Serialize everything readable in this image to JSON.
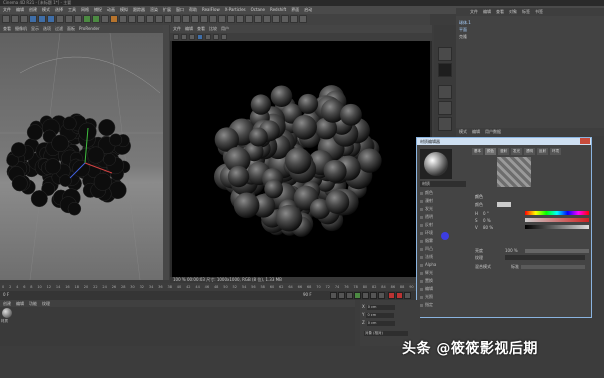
{
  "window": {
    "title": "Cinema 4D R21 - [未标题 1*] - 主要"
  },
  "menubar": [
    "文件",
    "编辑",
    "创建",
    "模式",
    "选择",
    "工具",
    "网格",
    "捕捉",
    "动画",
    "模拟",
    "跟踪器",
    "渲染",
    "扩展",
    "窗口",
    "帮助",
    "RealFlow",
    "X-Particles",
    "Octane",
    "Redshift",
    "界面",
    "启动"
  ],
  "left_viewport": {
    "menu": [
      "查看",
      "摄像机",
      "显示",
      "选项",
      "过滤",
      "面板",
      "ProRender"
    ]
  },
  "render_window": {
    "menu": [
      "文件",
      "编辑",
      "查看",
      "比较",
      "用户"
    ],
    "status": "100 %      00:00:03    尺寸: 1000x1000, RGB (8 位), 1.33 MB"
  },
  "object_manager": {
    "menu": [
      "文件",
      "编辑",
      "查看",
      "对象",
      "标签",
      "书签"
    ],
    "rows": [
      "球体.1",
      "平面",
      "克隆"
    ]
  },
  "attribute_manager": {
    "menu": [
      "模式",
      "编辑",
      "用户数据"
    ]
  },
  "material_editor": {
    "title": "材质编辑器",
    "material_name": "材质",
    "tabs": [
      "基本",
      "颜色",
      "漫射",
      "发光",
      "透明",
      "反射",
      "环境",
      "烟雾"
    ],
    "active_tab": "颜色",
    "channels": [
      "颜色",
      "漫射",
      "发光",
      "透明",
      "反射",
      "环境",
      "烟雾",
      "凹凸",
      "法线",
      "Alpha",
      "辉光",
      "置换",
      "编辑",
      "光照",
      "指定"
    ],
    "section": "颜色",
    "props": [
      {
        "label": "颜色"
      },
      {
        "label": "H",
        "value": "0 °"
      },
      {
        "label": "S",
        "value": "0 %"
      },
      {
        "label": "V",
        "value": "80 %"
      },
      {
        "label": "亮度",
        "value": "100 %"
      },
      {
        "label": "纹理"
      },
      {
        "label": "混合模式",
        "value": "标准"
      }
    ]
  },
  "timeline": {
    "ticks": [
      "0",
      "2",
      "4",
      "6",
      "8",
      "10",
      "12",
      "14",
      "16",
      "18",
      "20",
      "22",
      "24",
      "26",
      "28",
      "30",
      "32",
      "34",
      "36",
      "38",
      "40",
      "42",
      "44",
      "46",
      "48",
      "50",
      "52",
      "54",
      "56",
      "58",
      "60",
      "62",
      "64",
      "66",
      "68",
      "70",
      "72",
      "74",
      "76",
      "78",
      "80",
      "82",
      "84",
      "86",
      "88",
      "90"
    ],
    "start_frame": "0 F",
    "end_frame": "90 F"
  },
  "material_manager": {
    "menu": [
      "创建",
      "编辑",
      "功能",
      "纹理"
    ],
    "swatch_label": "材质"
  },
  "coordinates": {
    "rows": [
      {
        "axis": "X",
        "value": "0 cm"
      },
      {
        "axis": "Y",
        "value": "0 cm"
      },
      {
        "axis": "Z",
        "value": "0 cm"
      },
      {
        "axis": "",
        "value": "对象 (相对)"
      }
    ]
  },
  "watermark": "头条 @筱筱影视后期",
  "colors": {
    "render_bg": "#000000",
    "dialog_border": "#8ab4e0",
    "accent_blue": "#3f6ea8"
  }
}
